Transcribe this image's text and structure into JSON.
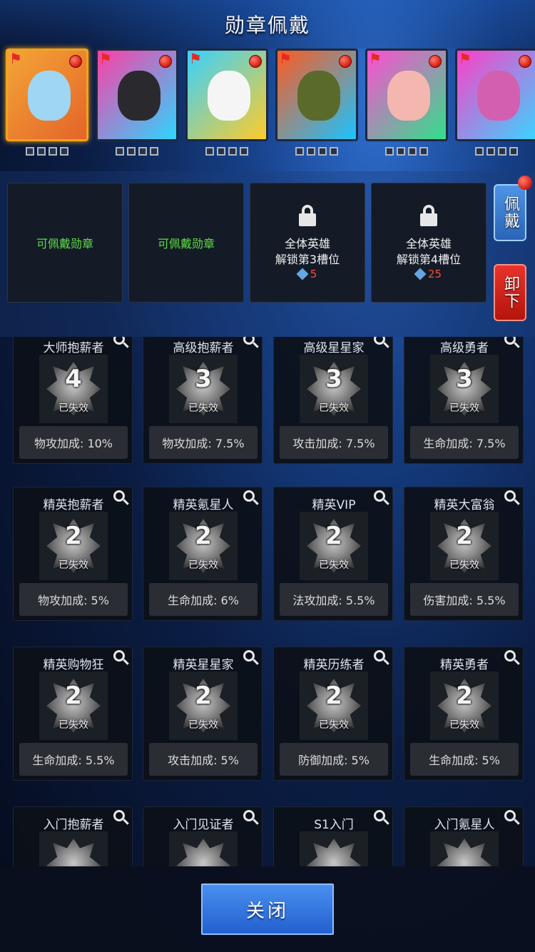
{
  "title": "勋章佩戴",
  "heroes": [
    {
      "colors": [
        "#f3a535",
        "#e4642a"
      ],
      "face": "#9fd6f3",
      "selected": true,
      "slots": 4
    },
    {
      "colors": [
        "#ff3ea6",
        "#2bd6ff"
      ],
      "face": "#2a2a2e",
      "selected": false,
      "slots": 4
    },
    {
      "colors": [
        "#38d1ff",
        "#ffcc2a"
      ],
      "face": "#f5f5f5",
      "selected": false,
      "slots": 4
    },
    {
      "colors": [
        "#ff5a1f",
        "#19c4ff"
      ],
      "face": "#5a6a2a",
      "selected": false,
      "slots": 4
    },
    {
      "colors": [
        "#ff4dd2",
        "#30e08a"
      ],
      "face": "#f4b7b0",
      "selected": false,
      "slots": 4
    },
    {
      "colors": [
        "#ff3ec7",
        "#3ad4ff"
      ],
      "face": "#d35fb0",
      "selected": false,
      "slots": 4
    }
  ],
  "badge_slots": {
    "open_label": "可佩戴勋章",
    "locked": [
      {
        "line1": "全体英雄",
        "line2": "解锁第3槽位",
        "cost": "5"
      },
      {
        "line1": "全体英雄",
        "line2": "解锁第4槽位",
        "cost": "25"
      }
    ]
  },
  "actions": {
    "wear": "佩戴",
    "remove": "卸下",
    "close": "关闭"
  },
  "medals": [
    {
      "name": "大师抱薪者",
      "level": "4",
      "status": "已失效",
      "bonus": "物攻加成: 10%"
    },
    {
      "name": "高级抱薪者",
      "level": "3",
      "status": "已失效",
      "bonus": "物攻加成: 7.5%"
    },
    {
      "name": "高级星星家",
      "level": "3",
      "status": "已失效",
      "bonus": "攻击加成: 7.5%"
    },
    {
      "name": "高级勇者",
      "level": "3",
      "status": "已失效",
      "bonus": "生命加成: 7.5%"
    },
    {
      "name": "精英抱薪者",
      "level": "2",
      "status": "已失效",
      "bonus": "物攻加成: 5%"
    },
    {
      "name": "精英氪星人",
      "level": "2",
      "status": "已失效",
      "bonus": "生命加成: 6%"
    },
    {
      "name": "精英VIP",
      "level": "2",
      "status": "已失效",
      "bonus": "法攻加成: 5.5%"
    },
    {
      "name": "精英大富翁",
      "level": "2",
      "status": "已失效",
      "bonus": "伤害加成: 5.5%"
    },
    {
      "name": "精英购物狂",
      "level": "2",
      "status": "已失效",
      "bonus": "生命加成: 5.5%"
    },
    {
      "name": "精英星星家",
      "level": "2",
      "status": "已失效",
      "bonus": "攻击加成: 5%"
    },
    {
      "name": "精英历练者",
      "level": "2",
      "status": "已失效",
      "bonus": "防御加成: 5%"
    },
    {
      "name": "精英勇者",
      "level": "2",
      "status": "已失效",
      "bonus": "生命加成: 5%"
    },
    {
      "name": "入门抱薪者",
      "level": "",
      "status": "",
      "bonus": ""
    },
    {
      "name": "入门见证者",
      "level": "",
      "status": "",
      "bonus": ""
    },
    {
      "name": "S1入门",
      "level": "",
      "status": "",
      "bonus": ""
    },
    {
      "name": "入门氪星人",
      "level": "",
      "status": "",
      "bonus": ""
    }
  ]
}
